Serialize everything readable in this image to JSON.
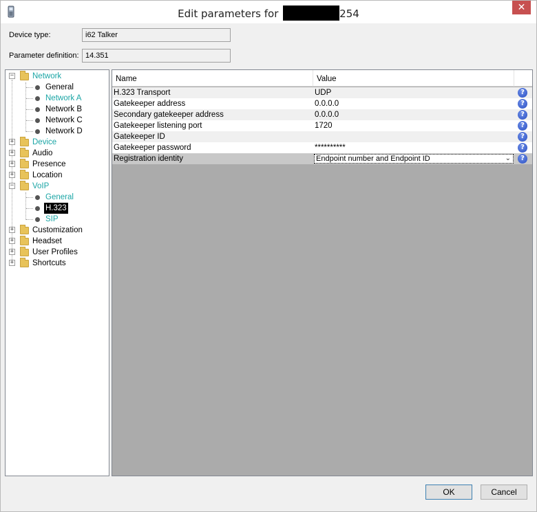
{
  "window": {
    "title_prefix": "Edit parameters for",
    "title_suffix": "254",
    "close_glyph": "✕"
  },
  "fields": {
    "device_type_label": "Device type:",
    "device_type_value": "i62 Talker",
    "param_def_label": "Parameter definition:",
    "param_def_value": "14.351"
  },
  "tree": {
    "network": "Network",
    "network_general": "General",
    "network_a": "Network A",
    "network_b": "Network B",
    "network_c": "Network C",
    "network_d": "Network D",
    "device": "Device",
    "audio": "Audio",
    "presence": "Presence",
    "location": "Location",
    "voip": "VoIP",
    "voip_general": "General",
    "voip_h323": "H.323",
    "voip_sip": "SIP",
    "customization": "Customization",
    "headset": "Headset",
    "user_profiles": "User Profiles",
    "shortcuts": "Shortcuts"
  },
  "grid": {
    "col_name": "Name",
    "col_value": "Value",
    "rows": [
      {
        "name": "H.323 Transport",
        "value": "UDP"
      },
      {
        "name": "Gatekeeper address",
        "value": "0.0.0.0"
      },
      {
        "name": "Secondary gatekeeper address",
        "value": "0.0.0.0"
      },
      {
        "name": "Gatekeeper listening port",
        "value": "1720"
      },
      {
        "name": "Gatekeeper ID",
        "value": ""
      },
      {
        "name": "Gatekeeper password",
        "value": "**********"
      },
      {
        "name": "Registration identity",
        "value": "Endpoint number and Endpoint ID"
      }
    ],
    "help_glyph": "?",
    "dropdown_chevron": "⌄"
  },
  "buttons": {
    "ok": "OK",
    "cancel": "Cancel"
  },
  "colors": {
    "accent_teal": "#1aa5a5",
    "close_red": "#c75050",
    "grid_bg": "#ababab"
  }
}
